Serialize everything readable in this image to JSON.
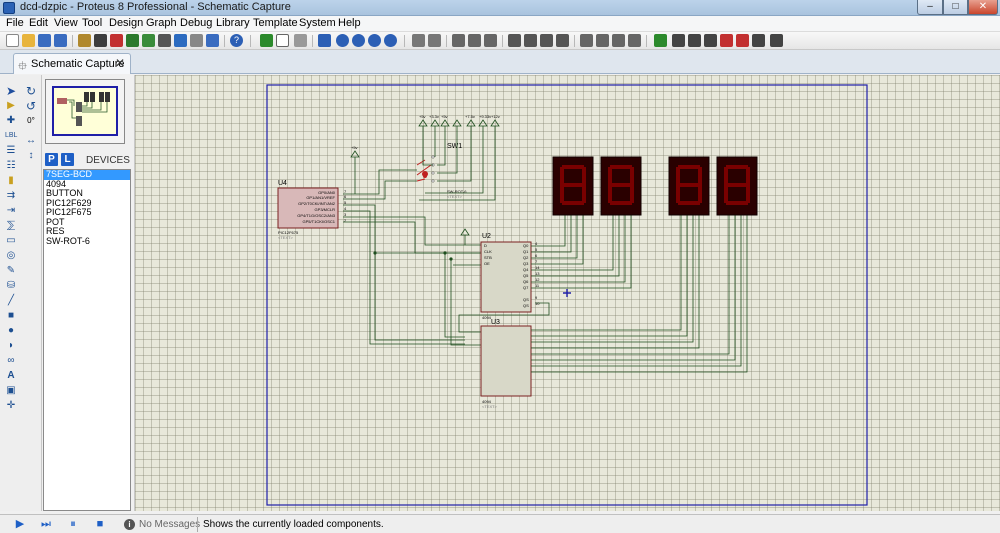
{
  "window": {
    "title": "dcd-dzpic - Proteus 8 Professional - Schematic Capture",
    "min_symbol": "–",
    "max_symbol": "□",
    "close_symbol": "✕"
  },
  "menu": [
    "File",
    "Edit",
    "View",
    "Tool",
    "Design",
    "Graph",
    "Debug",
    "Library",
    "Template",
    "System",
    "Help"
  ],
  "tab": {
    "label": "Schematic Capture",
    "close_symbol": "✕"
  },
  "toolstrip": {
    "rotation": "0°"
  },
  "device_panel": {
    "p_label": "P",
    "l_label": "L",
    "title": "DEVICES",
    "items": [
      "7SEG-BCD",
      "4094",
      "BUTTON",
      "PIC12F629",
      "PIC12F675",
      "POT",
      "RES",
      "SW-ROT-6"
    ],
    "selected_index": 0
  },
  "schematic": {
    "u4": {
      "ref": "U4",
      "part": "PIC12F675",
      "text": "<TEXT>",
      "pins": [
        "GP0/AN0",
        "GP1/AN1/VREF",
        "GP2/T0CKI/INT/AN2",
        "GP3/MCLR",
        "GP4/T1G/OSC2/AN3",
        "GP5/T1CKI/OSC1"
      ],
      "pin_numbers": [
        "7",
        "6",
        "5",
        "4",
        "3",
        "2"
      ]
    },
    "u2": {
      "ref": "U2",
      "part": "4094",
      "text": "<TEXT>",
      "left_pins": [
        "D",
        "CLK",
        "STB",
        "OE"
      ],
      "left_nums": [
        "2",
        "3",
        "1",
        "15"
      ],
      "right_pins": [
        "Q0",
        "Q1",
        "Q2",
        "Q3",
        "Q4",
        "Q5",
        "Q6",
        "Q7"
      ],
      "right_nums": [
        "4",
        "5",
        "6",
        "7",
        "14",
        "13",
        "12",
        "11"
      ],
      "qs_pins": [
        "QS",
        "QS"
      ],
      "qs_nums": [
        "9",
        "10"
      ]
    },
    "u3": {
      "ref": "U3",
      "part": "4094",
      "text": "<TEXT>"
    },
    "sw1": {
      "ref": "SW1",
      "part": "SW-ROT-6",
      "text": "<TEXT>"
    },
    "power_labels": [
      "+5v",
      "+5v",
      "+3.3v",
      "+5v",
      "+7.5v",
      "+9.33v",
      "+12v"
    ],
    "vcc_label": "+5v"
  },
  "status": {
    "message_count": "No Messages",
    "text": "Shows the currently loaded components."
  },
  "colors": {
    "wire": "#1e4e1e",
    "chip_fill": "#d8b8b8",
    "chip_border": "#7a2020",
    "seg_body": "#2a0000",
    "seg_on": "#7a0000",
    "sheet_border": "#1f1fa8"
  }
}
